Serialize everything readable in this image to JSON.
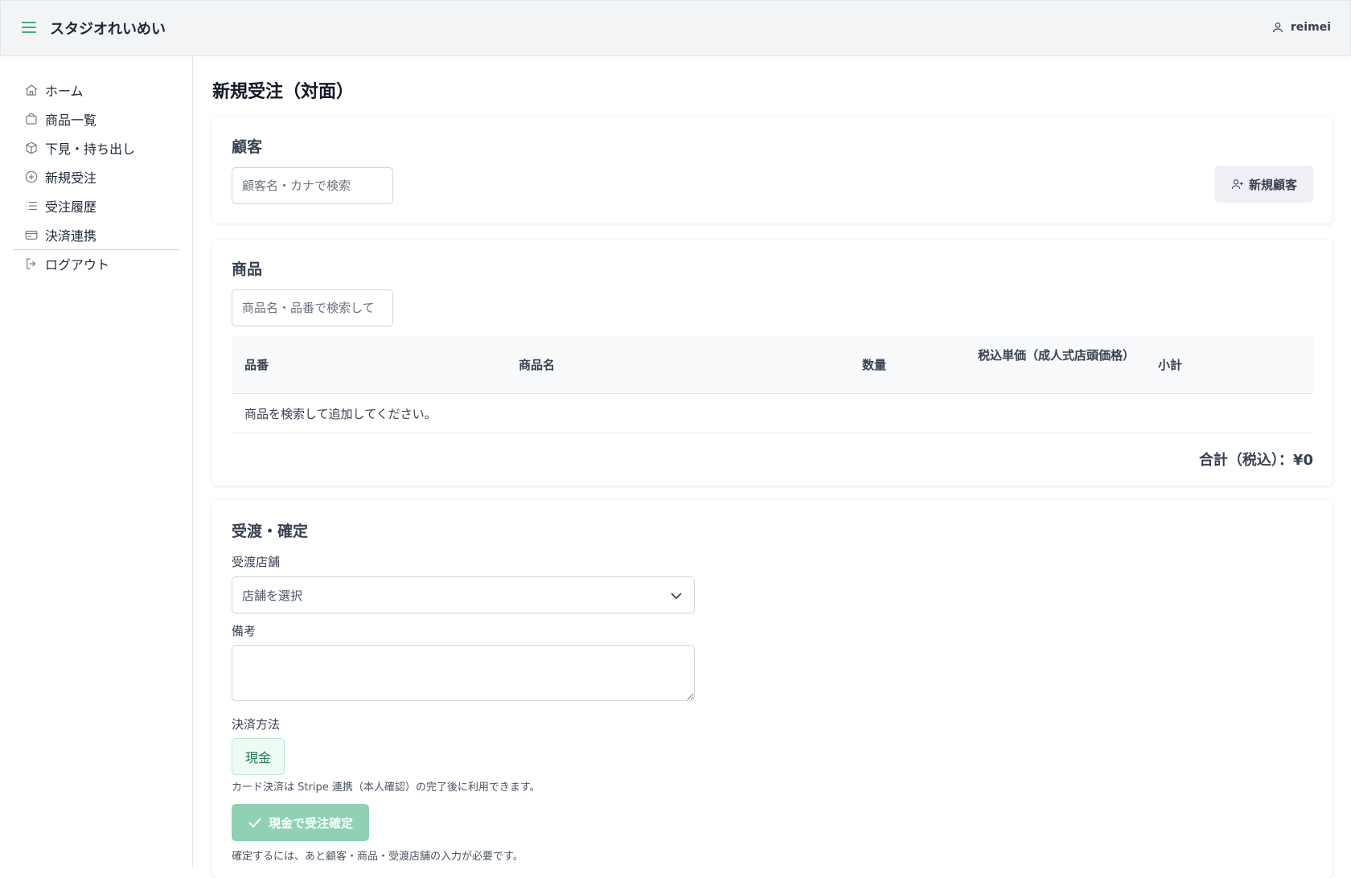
{
  "header": {
    "app_title": "スタジオれいめい",
    "username": "reimei"
  },
  "sidebar": {
    "items": [
      {
        "label": "ホーム",
        "icon": "home-icon"
      },
      {
        "label": "商品一覧",
        "icon": "shopping-bag-icon"
      },
      {
        "label": "下見・持ち出し",
        "icon": "package-icon"
      },
      {
        "label": "新規受注",
        "icon": "plus-circle-icon"
      },
      {
        "label": "受注履歴",
        "icon": "list-icon"
      },
      {
        "label": "決済連携",
        "icon": "credit-card-icon"
      }
    ],
    "logout": {
      "label": "ログアウト",
      "icon": "logout-icon"
    }
  },
  "page": {
    "title": "新規受注（対面）"
  },
  "customer": {
    "title": "顧客",
    "search_placeholder": "顧客名・カナで検索",
    "new_customer_label": "新規顧客"
  },
  "products": {
    "title": "商品",
    "search_placeholder": "商品名・品番で検索して",
    "columns": [
      "品番",
      "商品名",
      "数量",
      "税込単価（成人式店頭価格）",
      "小計"
    ],
    "empty_message": "商品を検索して追加してください。",
    "total_label": "合計（税込）：¥0"
  },
  "delivery": {
    "title": "受渡・確定",
    "store_label": "受渡店舗",
    "store_selected": "店舗を選択",
    "notes_label": "備考",
    "payment_label": "決済方法",
    "payment_option": "現金",
    "card_note": "カード決済は Stripe 連携（本人確認）の完了後に利用できます。",
    "confirm_label": "現金で受注確定",
    "required_note": "確定するには、あと顧客・商品・受渡店舗の入力が必要です。"
  },
  "colors": {
    "accent": "#3fae7f",
    "confirm_disabled": "#8fd1b3"
  }
}
